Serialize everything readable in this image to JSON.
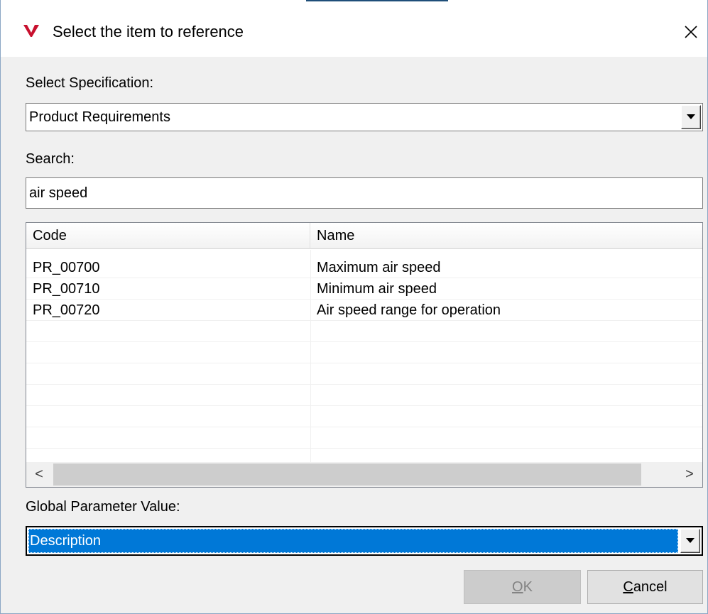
{
  "window": {
    "title": "Select the item to reference",
    "close_symbol": "✕",
    "accent_color": "#c8102e"
  },
  "specification": {
    "label": "Select Specification:",
    "selected": "Product Requirements"
  },
  "search": {
    "label": "Search:",
    "value": "air speed"
  },
  "table": {
    "columns": [
      "Code",
      "Name"
    ],
    "rows": [
      {
        "code": "PR_00700",
        "name": "Maximum air speed"
      },
      {
        "code": "PR_00710",
        "name": "Minimum air speed"
      },
      {
        "code": "PR_00720",
        "name": "Air speed range for operation"
      }
    ],
    "scroll_left": "<",
    "scroll_right": ">"
  },
  "global_parameter": {
    "label": "Global Parameter Value:",
    "selected": "Description"
  },
  "buttons": {
    "ok": {
      "mnemonic": "O",
      "rest": "K"
    },
    "cancel": {
      "mnemonic": "C",
      "rest": "ancel"
    }
  }
}
